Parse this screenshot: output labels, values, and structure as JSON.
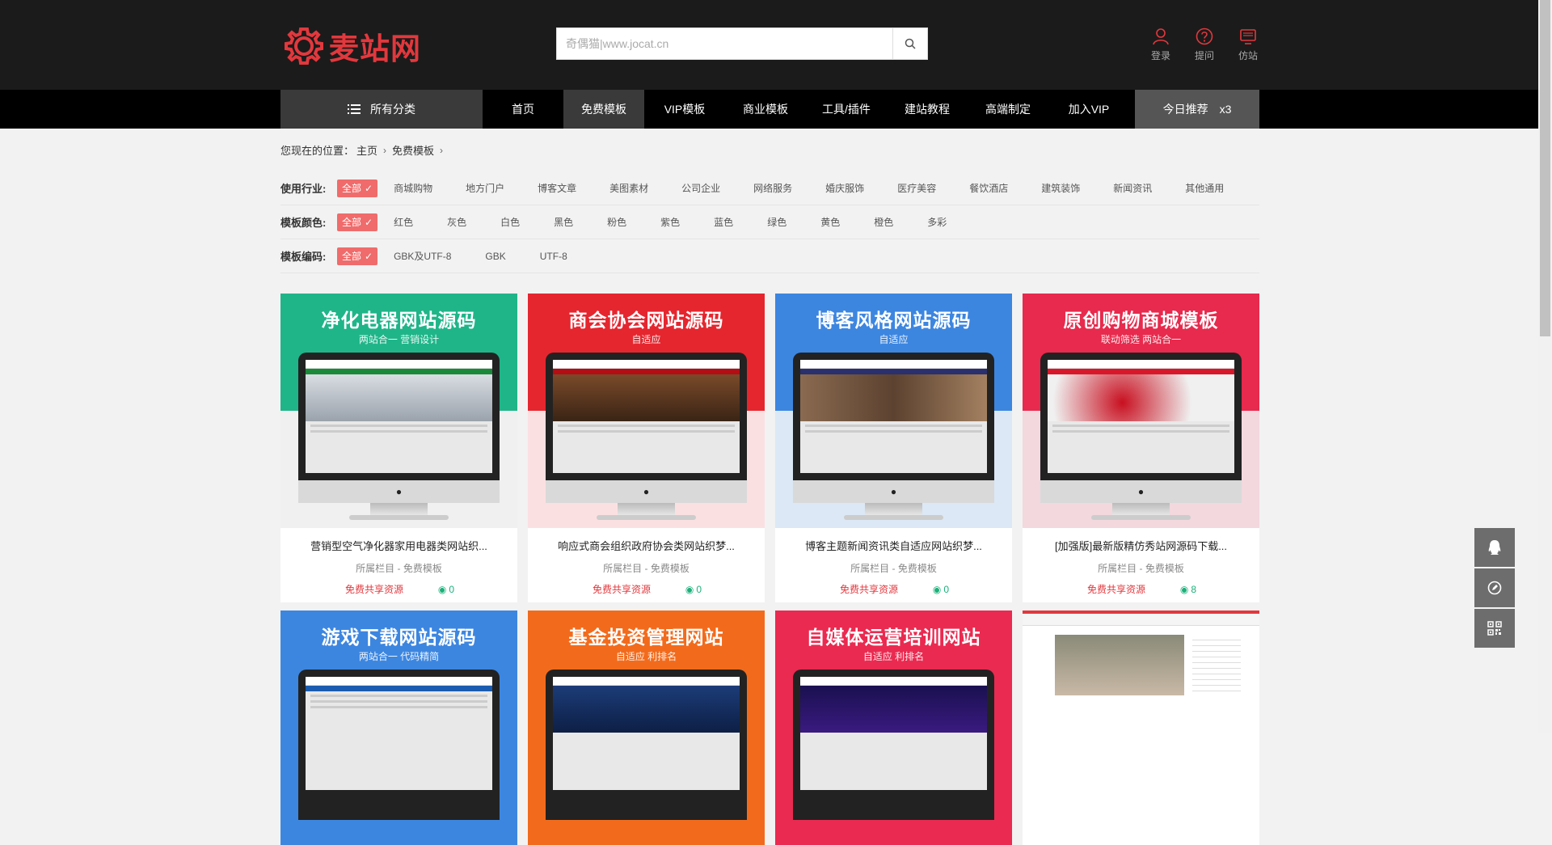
{
  "header": {
    "logo_text": "麦站网",
    "search_placeholder": "奇偶猫|www.jocat.cn",
    "links": [
      {
        "label": "登录",
        "icon": "user-icon"
      },
      {
        "label": "提问",
        "icon": "question-icon"
      },
      {
        "label": "仿站",
        "icon": "monitor-icon"
      }
    ]
  },
  "nav": {
    "category_label": "所有分类",
    "items": [
      "首页",
      "免费模板",
      "VIP模板",
      "商业模板",
      "工具/插件",
      "建站教程",
      "高端制定",
      "加入VIP"
    ],
    "active": "免费模板",
    "today_label": "今日推荐",
    "today_count": "x3"
  },
  "breadcrumb": {
    "prefix": "您现在的位置：",
    "home": "主页",
    "current": "免费模板"
  },
  "filters": [
    {
      "label": "使用行业:",
      "all": "全部",
      "options": [
        "商城购物",
        "地方门户",
        "博客文章",
        "美图素材",
        "公司企业",
        "网络服务",
        "婚庆服饰",
        "医疗美容",
        "餐饮酒店",
        "建筑装饰",
        "新闻资讯",
        "其他通用"
      ]
    },
    {
      "label": "模板颜色:",
      "all": "全部",
      "options": [
        "红色",
        "灰色",
        "白色",
        "黑色",
        "粉色",
        "紫色",
        "蓝色",
        "绿色",
        "黄色",
        "橙色",
        "多彩"
      ]
    },
    {
      "label": "模板编码:",
      "all": "全部",
      "options": [
        "GBK及UTF-8",
        "GBK",
        "UTF-8"
      ]
    }
  ],
  "cards": [
    {
      "banner": "净化电器网站源码",
      "tagline": "两站合一 营销设计",
      "color": "#1fb589",
      "title": "营销型空气净化器家用电器类网站织...",
      "category": "所属栏目 - 免费模板",
      "price": "免费共享资源",
      "views": "0"
    },
    {
      "banner": "商会协会网站源码",
      "tagline": "自适应",
      "color": "#e5262f",
      "title": "响应式商会组织政府协会类网站织梦...",
      "category": "所属栏目 - 免费模板",
      "price": "免费共享资源",
      "views": "0"
    },
    {
      "banner": "博客风格网站源码",
      "tagline": "自适应",
      "color": "#3c86e0",
      "title": "博客主题新闻资讯类自适应网站织梦...",
      "category": "所属栏目 - 免费模板",
      "price": "免费共享资源",
      "views": "0"
    },
    {
      "banner": "原创购物商城模板",
      "tagline": "联动筛选 两站合一",
      "color": "#e72a4d",
      "title": "[加强版]最新版精仿秀站网源码下载...",
      "category": "所属栏目 - 免费模板",
      "price": "免费共享资源",
      "views": "8"
    },
    {
      "banner": "游戏下载网站源码",
      "tagline": "两站合一 代码精简",
      "color": "#3c86e0"
    },
    {
      "banner": "基金投资管理网站",
      "tagline": "自适应 利排名",
      "color": "#f26b1c"
    },
    {
      "banner": "自媒体运营培训网站",
      "tagline": "自适应 利排名",
      "color": "#ea2a50"
    },
    {
      "banner": "",
      "tagline": "",
      "color": "#ffffff"
    }
  ],
  "floating": [
    "qq-icon",
    "edit-icon",
    "qrcode-icon"
  ]
}
